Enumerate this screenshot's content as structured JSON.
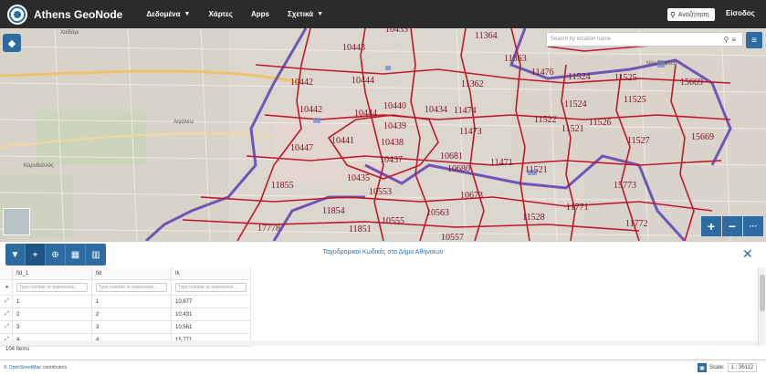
{
  "navbar": {
    "brand": "Athens GeoNode",
    "items": [
      {
        "label": "Δεδομένα",
        "dropdown": true
      },
      {
        "label": "Χάρτες",
        "dropdown": false
      },
      {
        "label": "Apps",
        "dropdown": false
      },
      {
        "label": "Σχετικά",
        "dropdown": true
      }
    ],
    "search_placeholder": "Αναζήτηση",
    "login": "Είσοδος"
  },
  "map": {
    "location_search_placeholder": "Search by location name",
    "place_labels": [
      "Χαϊδάρι",
      "Αιγάλεω",
      "Κορυδαλλός",
      "Νέα Κηφισιά"
    ],
    "zone_labels": [
      "10433",
      "11364",
      "10443",
      "11363",
      "11476",
      "11524",
      "11525",
      "15669",
      "10442",
      "10444",
      "11362",
      "10442",
      "10440",
      "10434",
      "11474",
      "11524",
      "11525",
      "10444",
      "11522",
      "11526",
      "10439",
      "11521",
      "11473",
      "10441",
      "10438",
      "11527",
      "15669",
      "10447",
      "10437",
      "10681",
      "11471",
      "10680",
      "11521",
      "10435",
      "15773",
      "11855",
      "10553",
      "10673",
      "11771",
      "11854",
      "10563",
      "11528",
      "11772",
      "10555",
      "11851",
      "17778",
      "10557"
    ],
    "zoom_in": "+",
    "zoom_out": "−",
    "more": "···"
  },
  "table": {
    "title": "Ταχυδρομικοί Κωδικές στο Δήμο Αθηναίων",
    "columns": [
      "fid_1",
      "fid",
      "tk"
    ],
    "filter_placeholder": "Type number or expression...",
    "rows": [
      [
        "1",
        "1",
        "10,677"
      ],
      [
        "2",
        "2",
        "10,431"
      ],
      [
        "3",
        "3",
        "10,561"
      ],
      [
        "4",
        "4",
        "15,771"
      ]
    ],
    "items_count": "104 Items"
  },
  "footer": {
    "attribution_prefix": "©",
    "attribution_link": "OpenStreetMap",
    "attribution_suffix": "contributors",
    "scale_label": "Scale:",
    "scale_value": "1 : 36112"
  },
  "colors": {
    "brand": "#2d6ca2",
    "navbar": "#2b2b2b",
    "boundary": "#c0182a",
    "district": "#5d3fb3"
  }
}
